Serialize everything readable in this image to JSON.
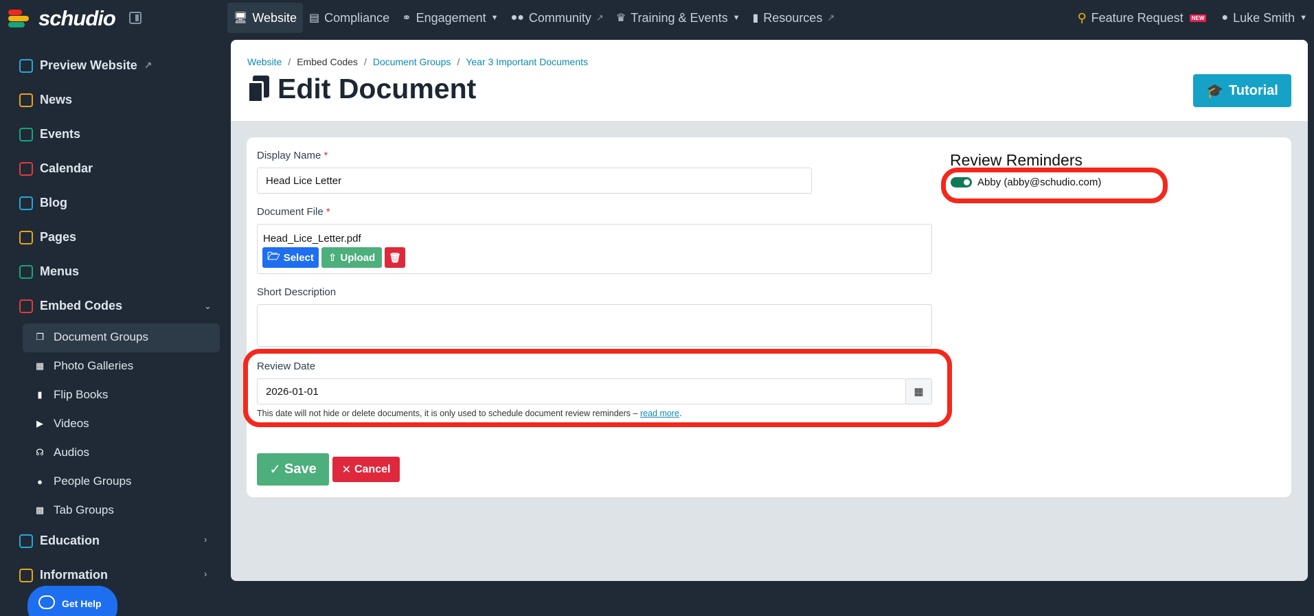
{
  "topbar": {
    "brand": "schudio",
    "nav": [
      {
        "label": "Website",
        "icon": "monitor-icon",
        "active": true
      },
      {
        "label": "Compliance",
        "icon": "clipboard-icon"
      },
      {
        "label": "Engagement",
        "icon": "handshake-icon"
      },
      {
        "label": "Community",
        "icon": "users-icon"
      },
      {
        "label": "Training & Events",
        "icon": "trophy-icon"
      },
      {
        "label": "Resources",
        "icon": "file-icon"
      }
    ],
    "feature_request": "Feature Request",
    "new_badge": "NEW",
    "user": "Luke Smith"
  },
  "sidebar": {
    "items": [
      {
        "label": "Preview Website",
        "color": "#2aa5d6"
      },
      {
        "label": "News",
        "color": "#e8a21c"
      },
      {
        "label": "Events",
        "color": "#1aa37a"
      },
      {
        "label": "Calendar",
        "color": "#e03c3c"
      },
      {
        "label": "Blog",
        "color": "#2aa5d6"
      },
      {
        "label": "Pages",
        "color": "#e8a21c"
      },
      {
        "label": "Menus",
        "color": "#1aa37a"
      },
      {
        "label": "Embed Codes",
        "color": "#e03c3c"
      }
    ],
    "sub_items": [
      {
        "label": "Document Groups",
        "active": true
      },
      {
        "label": "Photo Galleries"
      },
      {
        "label": "Flip Books"
      },
      {
        "label": "Videos"
      },
      {
        "label": "Audios"
      },
      {
        "label": "People Groups"
      },
      {
        "label": "Tab Groups"
      }
    ],
    "education": "Education",
    "information": "Information",
    "get_help": "Get Help"
  },
  "breadcrumb": [
    "Website",
    "Embed Codes",
    "Document Groups",
    "Year 3 Important Documents"
  ],
  "page_title": "Edit Document",
  "tutorial_label": "Tutorial",
  "form": {
    "display_name_label": "Display Name",
    "display_name_value": "Head Lice Letter",
    "document_file_label": "Document File",
    "file_name": "Head_Lice_Letter.pdf",
    "select_label": "Select",
    "upload_label": "Upload",
    "short_description_label": "Short Description",
    "short_description_value": "",
    "review_date_label": "Review Date",
    "review_date_value": "2026-01-01",
    "review_help": "This date will not hide or delete documents, it is only used to schedule document review reminders –",
    "read_more": "read more",
    "save_label": "Save",
    "cancel_label": "Cancel"
  },
  "reminders": {
    "title": "Review Reminders",
    "person": "Abby (abby@schudio.com)",
    "enabled": true
  },
  "colors": {
    "accent": "#16a2c7",
    "success": "#4caf7c",
    "danger": "#e0283c",
    "primary": "#1e6ef0",
    "highlight": "#f3281b"
  }
}
